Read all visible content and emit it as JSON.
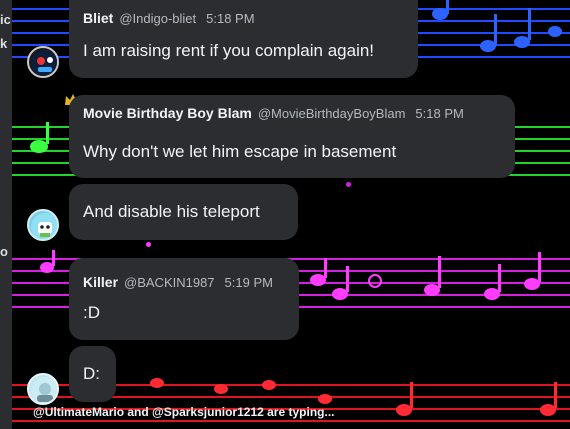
{
  "sidebar_fragments": {
    "top1": "ic",
    "top2": "k",
    "mid": "o"
  },
  "messages": [
    {
      "username": "Bliet",
      "handle": "@Indigo-bliet",
      "time": "5:18 PM",
      "text": "I am raising rent if you complain again!"
    },
    {
      "username": "Movie Birthday Boy Blam",
      "handle": "@MovieBirthdayBoyBlam",
      "time": "5:18 PM",
      "text": "Why don't we let him escape in basement"
    },
    {
      "text": "And disable his teleport"
    },
    {
      "username": "Killer",
      "handle": "@BACKIN1987",
      "time": "5:19 PM",
      "text": ":D"
    },
    {
      "text": "D:"
    }
  ],
  "typing_indicator": "@UltimateMario and @Sparksjunior1212 are typing...",
  "icons": {
    "crown": "crown-icon"
  },
  "colors": {
    "staff_blue": "#1e4bff",
    "staff_green": "#22d32a",
    "staff_magenta": "#d21fe0",
    "staff_red": "#e0141e",
    "bubble_bg": "#2b2d31",
    "crown": "#e3b420"
  }
}
